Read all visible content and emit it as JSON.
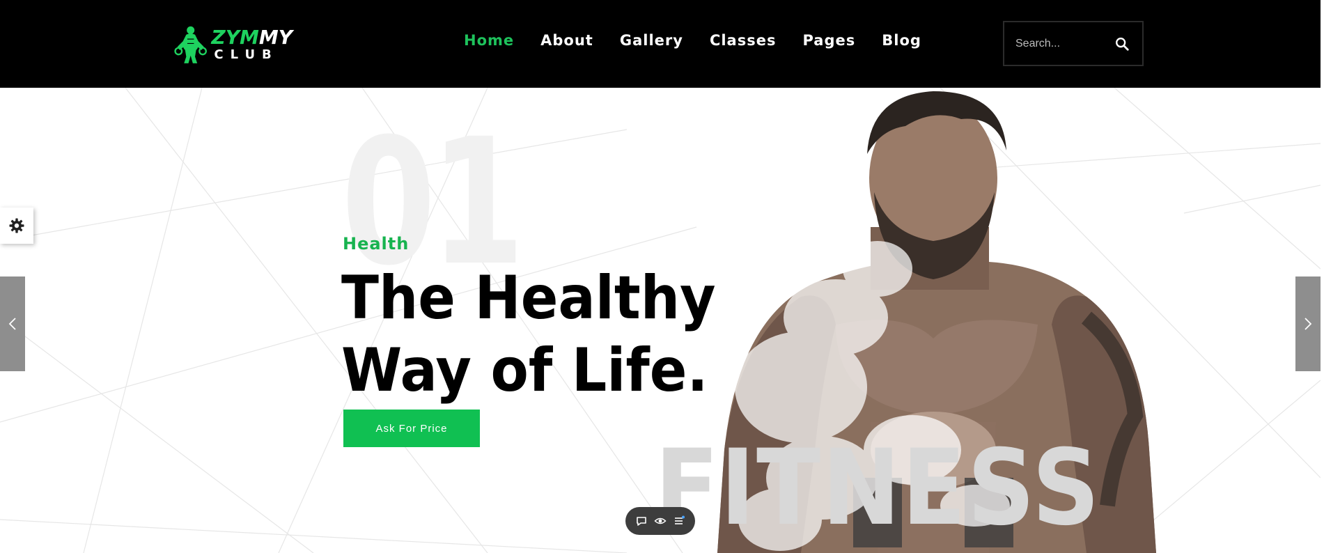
{
  "brand": {
    "logo_part1": "ZYM",
    "logo_part2": "MY",
    "logo_sub": "CLUB",
    "accent": "#1ec25c"
  },
  "nav": {
    "items": [
      {
        "label": "Home",
        "active": true
      },
      {
        "label": "About"
      },
      {
        "label": "Gallery"
      },
      {
        "label": "Classes"
      },
      {
        "label": "Pages"
      },
      {
        "label": "Blog"
      }
    ]
  },
  "search": {
    "placeholder": "Search...",
    "icon": "search-icon"
  },
  "hero": {
    "slide_number": "01",
    "tag": "Health",
    "headline_line1": "The Healthy",
    "headline_line2": "Way of Life.",
    "cta_label": "Ask For Price",
    "background_word": "FITNESS"
  },
  "side": {
    "settings_icon": "gear-icon",
    "prev_icon": "chevron-left-icon",
    "next_icon": "chevron-right-icon"
  },
  "toolbar": {
    "icons": [
      "chat-icon",
      "eye-icon",
      "list-icon"
    ]
  }
}
